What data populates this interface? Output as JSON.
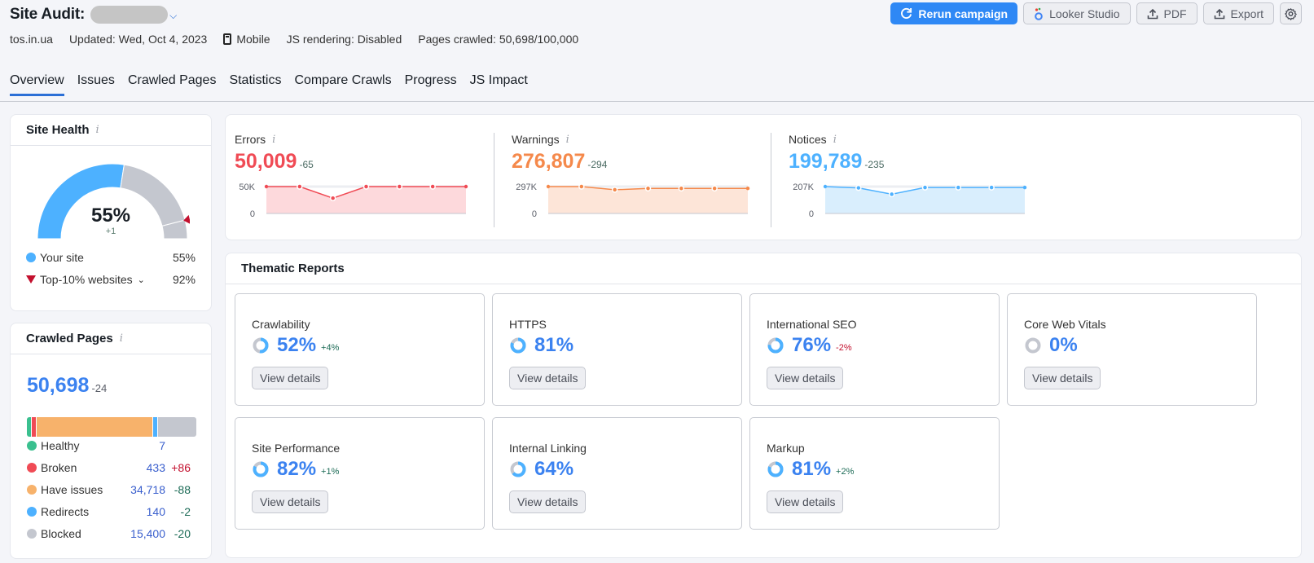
{
  "header": {
    "title": "Site Audit:",
    "domain": "tos.in.ua",
    "updated": "Updated: Wed, Oct 4, 2023",
    "device": "Mobile",
    "js_rendering": "JS rendering: Disabled",
    "pages_crawled": "Pages crawled: 50,698/100,000"
  },
  "actions": {
    "rerun": "Rerun campaign",
    "looker": "Looker Studio",
    "pdf": "PDF",
    "export": "Export"
  },
  "tabs": [
    "Overview",
    "Issues",
    "Crawled Pages",
    "Statistics",
    "Compare Crawls",
    "Progress",
    "JS Impact"
  ],
  "site_health": {
    "title": "Site Health",
    "value": "55%",
    "value_fraction": 0.55,
    "top10_fraction": 0.92,
    "delta": "+1",
    "legend": [
      {
        "label": "Your site",
        "value": "55%",
        "color": "#4db1ff"
      },
      {
        "label": "Top-10% websites",
        "value": "92%",
        "color": "#c3102e"
      }
    ]
  },
  "crawled_pages": {
    "title": "Crawled Pages",
    "total": "50,698",
    "delta": "-24",
    "rows": [
      {
        "label": "Healthy",
        "value": "7",
        "delta": "",
        "count": 7,
        "color": "#3ac08f"
      },
      {
        "label": "Broken",
        "value": "433",
        "delta": "+86",
        "count": 433,
        "color": "#f04b55"
      },
      {
        "label": "Have issues",
        "value": "34,718",
        "delta": "-88",
        "count": 34718,
        "color": "#f7b26b"
      },
      {
        "label": "Redirects",
        "value": "140",
        "delta": "-2",
        "count": 140,
        "color": "#4db1ff"
      },
      {
        "label": "Blocked",
        "value": "15,400",
        "delta": "-20",
        "count": 15400,
        "color": "#c4c7cf"
      }
    ]
  },
  "issues": [
    {
      "label": "Errors",
      "value": "50,009",
      "delta": "-65",
      "color": "#f04b55",
      "fill": "#fdd9dc",
      "ymax_label": "50K",
      "ymin_label": "0",
      "ymax": 50000,
      "series": [
        50000,
        50000,
        28500,
        50000,
        50000,
        50000,
        50000
      ]
    },
    {
      "label": "Warnings",
      "value": "276,807",
      "delta": "-294",
      "color": "#f5894b",
      "fill": "#fde5d8",
      "ymax_label": "297K",
      "ymin_label": "0",
      "ymax": 297000,
      "series": [
        297000,
        297000,
        262000,
        277000,
        277000,
        277000,
        277000
      ]
    },
    {
      "label": "Notices",
      "value": "199,789",
      "delta": "-235",
      "color": "#4db1ff",
      "fill": "#d9eefd",
      "ymax_label": "207K",
      "ymin_label": "0",
      "ymax": 207000,
      "series": [
        207000,
        197000,
        148000,
        200000,
        200000,
        200000,
        200000
      ]
    }
  ],
  "thematic": {
    "title": "Thematic Reports",
    "view_details": "View details",
    "reports": [
      {
        "name": "Crawlability",
        "pct": "52%",
        "frac": 0.52,
        "change": "+4%",
        "trend": "up"
      },
      {
        "name": "HTTPS",
        "pct": "81%",
        "frac": 0.81,
        "change": "",
        "trend": ""
      },
      {
        "name": "International SEO",
        "pct": "76%",
        "frac": 0.76,
        "change": "-2%",
        "trend": "down"
      },
      {
        "name": "Core Web Vitals",
        "pct": "0%",
        "frac": 0,
        "change": "",
        "trend": ""
      },
      {
        "name": "Site Performance",
        "pct": "82%",
        "frac": 0.82,
        "change": "+1%",
        "trend": "up"
      },
      {
        "name": "Internal Linking",
        "pct": "64%",
        "frac": 0.64,
        "change": "",
        "trend": ""
      },
      {
        "name": "Markup",
        "pct": "81%",
        "frac": 0.81,
        "change": "+2%",
        "trend": "up"
      }
    ]
  }
}
